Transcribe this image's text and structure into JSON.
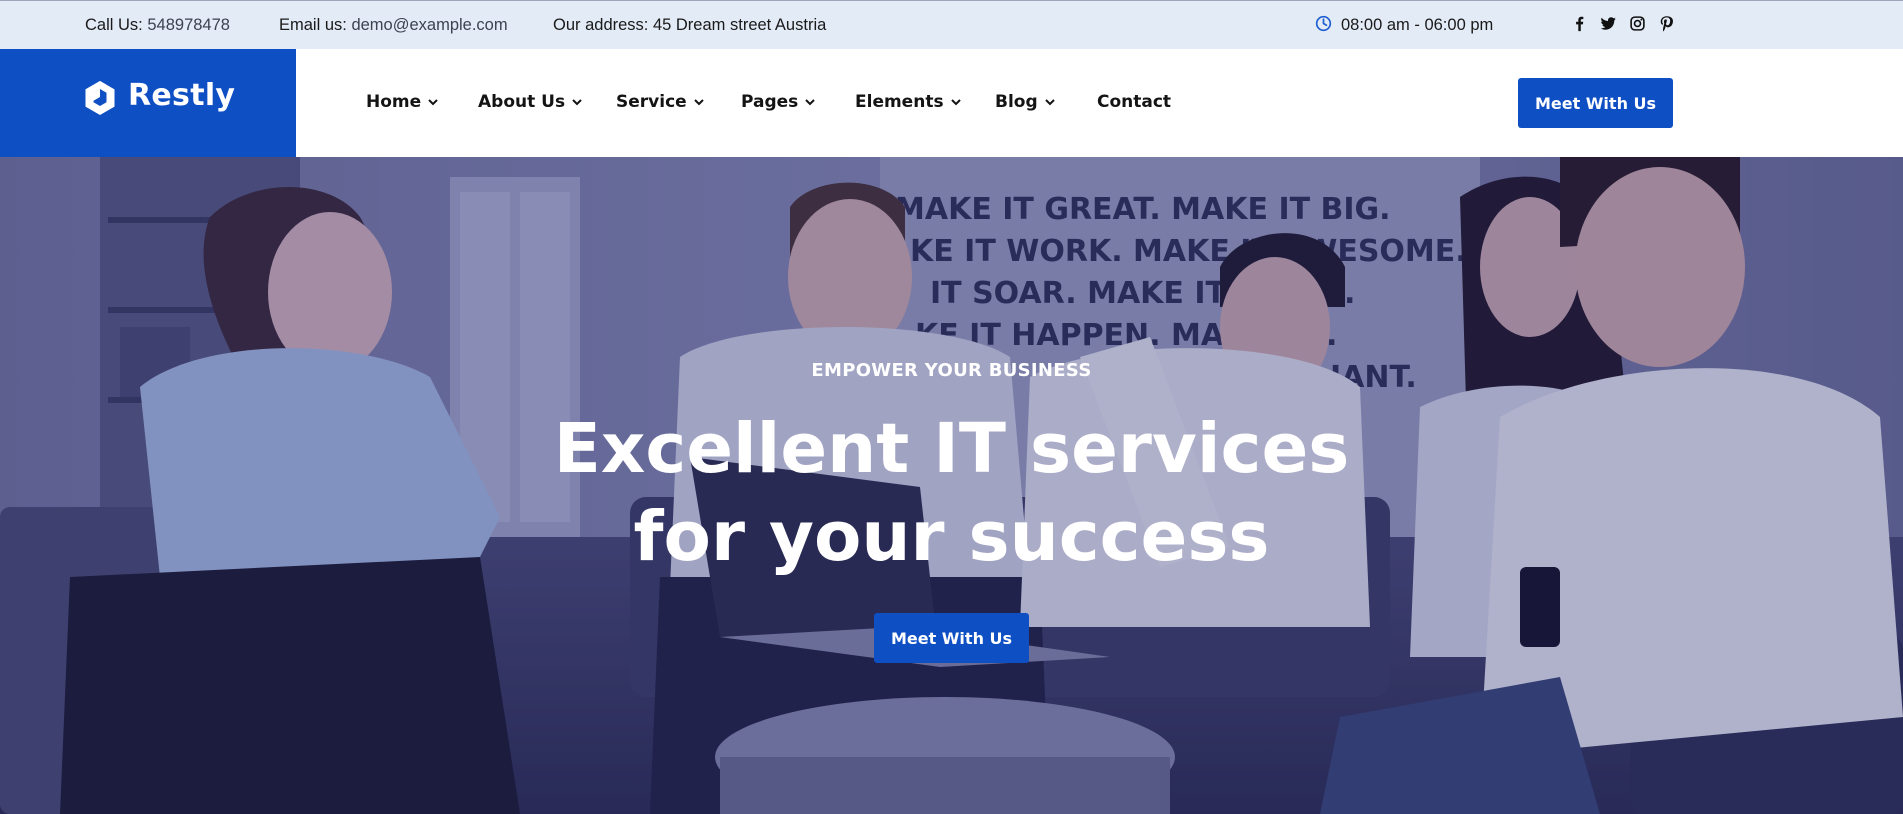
{
  "topbar": {
    "call_label": "Call Us:",
    "call_value": "548978478",
    "email_label": "Email us:",
    "email_value": "demo@example.com",
    "address": "Our address: 45 Dream street Austria",
    "hours": "08:00 am - 06:00 pm",
    "social_icons": [
      "facebook-icon",
      "twitter-icon",
      "instagram-icon",
      "pinterest-icon"
    ]
  },
  "brand": {
    "name": "Restly",
    "color": "#0f4fc4"
  },
  "nav": {
    "items": [
      {
        "label": "Home",
        "has_dropdown": true
      },
      {
        "label": "About Us",
        "has_dropdown": true
      },
      {
        "label": "Service",
        "has_dropdown": true
      },
      {
        "label": "Pages",
        "has_dropdown": true
      },
      {
        "label": "Elements",
        "has_dropdown": true
      },
      {
        "label": "Blog",
        "has_dropdown": true
      },
      {
        "label": "Contact",
        "has_dropdown": false
      }
    ],
    "cta_label": "Meet With Us"
  },
  "hero": {
    "eyebrow": "EMPOWER YOUR BUSINESS",
    "title_line1": "Excellent IT services",
    "title_line2": "for your success",
    "cta_label": "Meet With Us",
    "wall_lines": [
      "MAKE IT GREAT. MAKE IT BIG.",
      "KE IT WORK. MAKE IT AWESOME.",
      "IT SOAR. MAKE IT   ERFUL.",
      "KE IT HAPPEN. MA     MPLE.",
      "IANT."
    ]
  }
}
